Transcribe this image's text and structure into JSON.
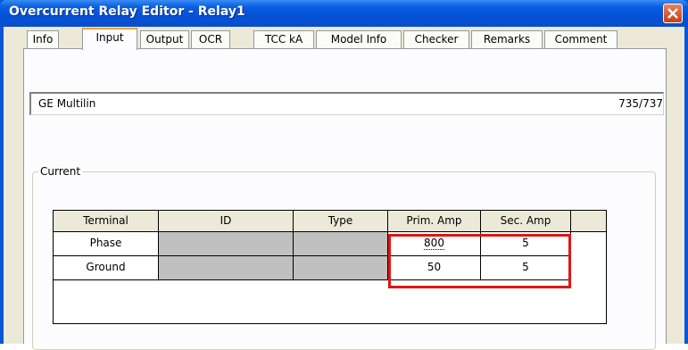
{
  "window": {
    "title": "Overcurrent Relay Editor - Relay1"
  },
  "tabs": [
    {
      "label": "Info"
    },
    {
      "label": "Input"
    },
    {
      "label": "Output"
    },
    {
      "label": "OCR"
    },
    {
      "label": "TCC kA"
    },
    {
      "label": "Model Info"
    },
    {
      "label": "Checker"
    },
    {
      "label": "Remarks"
    },
    {
      "label": "Comment"
    }
  ],
  "active_tab": "Input",
  "header": {
    "manufacturer": "GE Multilin",
    "count": "735/737"
  },
  "current": {
    "group_label": "Current",
    "columns": [
      "Terminal",
      "ID",
      "Type",
      "Prim. Amp",
      "Sec. Amp"
    ],
    "rows": [
      {
        "terminal": "Phase",
        "id": "",
        "type": "",
        "prim_amp": "800",
        "sec_amp": "5"
      },
      {
        "terminal": "Ground",
        "id": "",
        "type": "",
        "prim_amp": "50",
        "sec_amp": "5"
      }
    ]
  },
  "colors": {
    "title_bar": "#0a55d8",
    "highlight": "#e01616",
    "active_tab_accent": "#f1a239"
  }
}
